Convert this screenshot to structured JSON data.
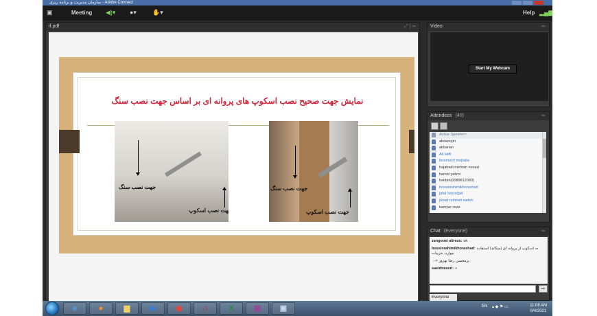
{
  "window": {
    "title": "سازمان مدیریت و برنامه ریزی - Adobe Connect"
  },
  "menubar": {
    "meeting": "Meeting",
    "help": "Help"
  },
  "share_pod": {
    "title": "if.pdf",
    "slide": {
      "title": "نمایش جهت صحیح نصب اسکوپ های پروانه ای بر اساس جهت نصب سنگ",
      "left_photo": {
        "label_stone": "جهت نصب سنگ",
        "label_scope": "جهت نصب اسکوپ"
      },
      "right_photo": {
        "label_stone": "جهت نصب سنگ",
        "label_scope": "جهت نصب اسکوپ"
      }
    }
  },
  "video_pod": {
    "title": "Video",
    "webcam_button": "Start My Webcam"
  },
  "attendees_pod": {
    "title": "Attendees",
    "count": "(40)",
    "rows": [
      {
        "text": "Active Speakers",
        "role": true,
        "hl": false
      },
      {
        "text": "abdanojiri",
        "role": false,
        "hl": false
      },
      {
        "text": "akbarian",
        "role": false,
        "hl": false
      },
      {
        "text": "Ali latifi",
        "role": false,
        "hl": true
      },
      {
        "text": "faramarzi mojtaba",
        "role": false,
        "hl": true
      },
      {
        "text": "hajabadi mehran nosazi",
        "role": false,
        "hl": false
      },
      {
        "text": "hamid yatimi",
        "role": false,
        "hl": false
      },
      {
        "text": "heidari(0089812080)",
        "role": false,
        "hl": false
      },
      {
        "text": "hossinrahimikhorashad",
        "role": false,
        "hl": true
      },
      {
        "text": "jafar barzegari",
        "role": false,
        "hl": true
      },
      {
        "text": "javad rahmati sadeh",
        "role": false,
        "hl": true
      },
      {
        "text": "kamyar reza",
        "role": false,
        "hl": false
      }
    ]
  },
  "chat_pod": {
    "title": "Chat",
    "scope": "(Everyone)",
    "messages": [
      {
        "sender": "zangooei alireza:",
        "text": "ok"
      },
      {
        "sender": "hossinrahimikhorashad:",
        "text": "ه، اسکوپ از پروانه ای (میکاند) استفاده موارد، جزییات"
      },
      {
        "sender": "",
        "text": "--> پرمحسن رضا بهروز"
      },
      {
        "sender": "saeidnaseri:",
        "text": "+"
      }
    ],
    "send_label": "⇨",
    "target": "Everyone"
  },
  "taskbar": {
    "lang": "EN",
    "time": "11:08 AM",
    "date": "8/4/2021"
  }
}
